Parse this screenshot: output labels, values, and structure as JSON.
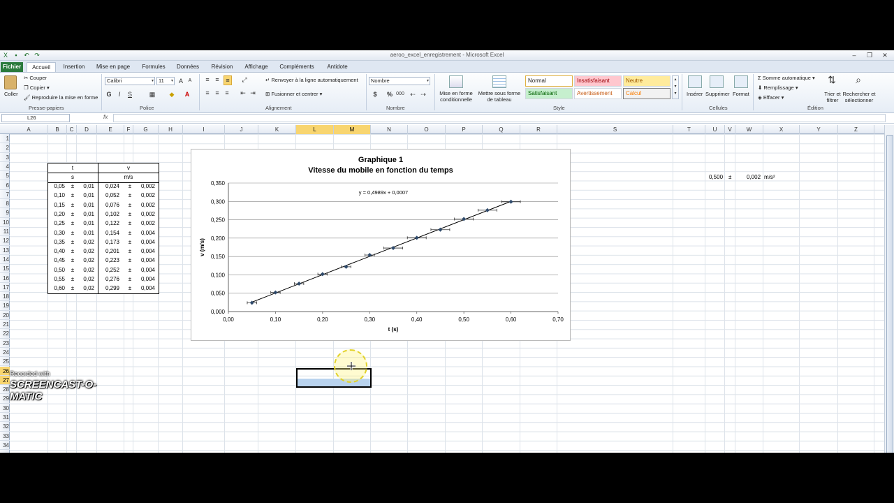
{
  "window": {
    "title": "aeroo_excel_enregistrement - Microsoft Excel"
  },
  "tabs": [
    "Fichier",
    "Accueil",
    "Insertion",
    "Mise en page",
    "Formules",
    "Données",
    "Révision",
    "Affichage",
    "Compléments",
    "Antidote"
  ],
  "ribbon": {
    "clipboard": {
      "paste": "Coller",
      "cut": "Couper",
      "copy": "Copier",
      "format_painter": "Reproduire la mise en forme",
      "label": "Presse-papiers"
    },
    "font": {
      "name": "Calibri",
      "size": "11",
      "bold": "G",
      "italic": "I",
      "underline": "S",
      "label": "Police"
    },
    "alignment": {
      "wrap": "Renvoyer à la ligne automatiquement",
      "merge": "Fusionner et centrer",
      "label": "Alignement"
    },
    "number": {
      "format": "Nombre",
      "currency": "$",
      "percent": "%",
      "thousands": "000",
      "label": "Nombre"
    },
    "styles": {
      "conditional": "Mise en forme conditionnelle",
      "as_table": "Mettre sous forme de tableau",
      "normal": "Normal",
      "insatisfaisant": "Insatisfaisant",
      "neutre": "Neutre",
      "satisfaisant": "Satisfaisant",
      "avertissement": "Avertissement",
      "calcul": "Calcul",
      "label": "Style"
    },
    "cells": {
      "insert": "Insérer",
      "delete": "Supprimer",
      "format": "Format",
      "label": "Cellules"
    },
    "editing": {
      "autosum": "Somme automatique",
      "fill": "Remplissage",
      "clear": "Effacer",
      "sort": "Trier et filtrer",
      "find": "Rechercher et sélectionner",
      "label": "Édition"
    }
  },
  "formula_bar": {
    "name_box": "L26",
    "fx": "fx",
    "content": ""
  },
  "columns": [
    "A",
    "B",
    "C",
    "D",
    "E",
    "F",
    "G",
    "H",
    "I",
    "J",
    "K",
    "L",
    "M",
    "N",
    "O",
    "P",
    "Q",
    "R",
    "S",
    "T",
    "U",
    "V",
    "W",
    "X",
    "Y",
    "Z"
  ],
  "rows": [
    "1",
    "2",
    "3",
    "4",
    "5",
    "6",
    "7",
    "8",
    "9",
    "10",
    "11",
    "12",
    "13",
    "14",
    "15",
    "16",
    "17",
    "18",
    "19",
    "20",
    "21",
    "22",
    "23",
    "24",
    "25",
    "26",
    "27",
    "28",
    "29",
    "30",
    "31",
    "32",
    "33",
    "34"
  ],
  "table": {
    "header_t": "t",
    "header_v": "v",
    "unit_t": "s",
    "unit_v": "m/s",
    "pm": "±",
    "rows": [
      {
        "t": "0,05",
        "dt": "0,01",
        "v": "0,024",
        "dv": "0,002"
      },
      {
        "t": "0,10",
        "dt": "0,01",
        "v": "0,052",
        "dv": "0,002"
      },
      {
        "t": "0,15",
        "dt": "0,01",
        "v": "0,076",
        "dv": "0,002"
      },
      {
        "t": "0,20",
        "dt": "0,01",
        "v": "0,102",
        "dv": "0,002"
      },
      {
        "t": "0,25",
        "dt": "0,01",
        "v": "0,122",
        "dv": "0,002"
      },
      {
        "t": "0,30",
        "dt": "0,01",
        "v": "0,154",
        "dv": "0,004"
      },
      {
        "t": "0,35",
        "dt": "0,02",
        "v": "0,173",
        "dv": "0,004"
      },
      {
        "t": "0,40",
        "dt": "0,02",
        "v": "0,201",
        "dv": "0,004"
      },
      {
        "t": "0,45",
        "dt": "0,02",
        "v": "0,223",
        "dv": "0,004"
      },
      {
        "t": "0,50",
        "dt": "0,02",
        "v": "0,252",
        "dv": "0,004"
      },
      {
        "t": "0,55",
        "dt": "0,02",
        "v": "0,276",
        "dv": "0,004"
      },
      {
        "t": "0,60",
        "dt": "0,02",
        "v": "0,299",
        "dv": "0,004"
      }
    ]
  },
  "slope": {
    "value": "0,500",
    "pm": "±",
    "error": "0,002",
    "unit": "m/s²"
  },
  "chart_data": {
    "type": "scatter",
    "title": "Graphique 1",
    "subtitle": "Vitesse du mobile en fonction du temps",
    "xlabel": "t (s)",
    "ylabel": "v (m/s)",
    "xlim": [
      0,
      0.7
    ],
    "ylim": [
      0,
      0.35
    ],
    "xticks": [
      "0,00",
      "0,10",
      "0,20",
      "0,30",
      "0,40",
      "0,50",
      "0,60",
      "0,70"
    ],
    "yticks": [
      "0,000",
      "0,050",
      "0,100",
      "0,150",
      "0,200",
      "0,250",
      "0,300",
      "0,350"
    ],
    "grid": true,
    "trendline_label": "y = 0,4989x + 0,0007",
    "trendline": {
      "slope": 0.4989,
      "intercept": 0.0007
    },
    "x": [
      0.05,
      0.1,
      0.15,
      0.2,
      0.25,
      0.3,
      0.35,
      0.4,
      0.45,
      0.5,
      0.55,
      0.6
    ],
    "y": [
      0.024,
      0.052,
      0.076,
      0.102,
      0.122,
      0.154,
      0.173,
      0.201,
      0.223,
      0.252,
      0.276,
      0.299
    ],
    "x_err": [
      0.01,
      0.01,
      0.01,
      0.01,
      0.01,
      0.01,
      0.02,
      0.02,
      0.02,
      0.02,
      0.02,
      0.02
    ],
    "y_err": [
      0.002,
      0.002,
      0.002,
      0.002,
      0.002,
      0.004,
      0.004,
      0.004,
      0.004,
      0.004,
      0.004,
      0.004
    ]
  },
  "watermark": {
    "recorded": "Recorded with",
    "brand": "SCREENCAST-O-MATIC"
  }
}
